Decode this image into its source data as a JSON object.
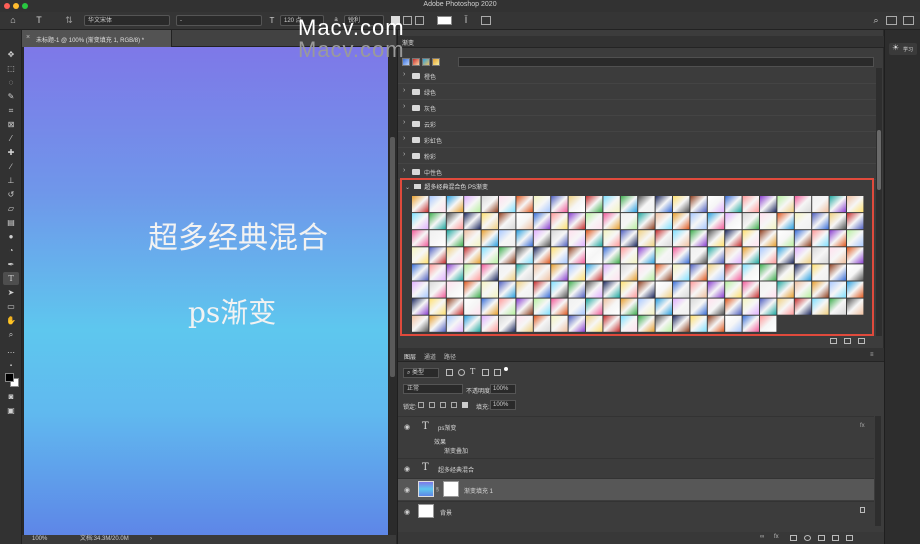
{
  "window": {
    "title": "Adobe Photoshop 2020"
  },
  "options_bar": {
    "font_family": "华文宋体",
    "font_style": "-",
    "font_size": "120 点",
    "antialias": "锐利"
  },
  "document": {
    "tab_title": "未标题-1 @ 100% (渐变填充 1, RGB/8) *",
    "canvas_text_1": "超多经典混合",
    "canvas_text_2": "ps渐变"
  },
  "status": {
    "zoom": "100%",
    "doc_info": "文档:34.3M/20.0M",
    "arrow": "›"
  },
  "gradients_panel": {
    "tab": "渐变",
    "folders": [
      "橙色",
      "绿色",
      "灰色",
      "云彩",
      "彩虹色",
      "粉彩",
      "中性色"
    ],
    "open_folder": "超多经典混合色 PS渐变"
  },
  "watermark": {
    "text": "Macv.com"
  },
  "layers_panel": {
    "tabs": [
      "图层",
      "通道",
      "路径"
    ],
    "filter_label": "类型",
    "blend_mode": "正常",
    "opacity_label": "不透明度:",
    "opacity_value": "100%",
    "lock_label": "锁定:",
    "fill_label": "填充:",
    "fill_value": "100%",
    "fx_label": "fx",
    "layers": [
      {
        "name": "ps渐变",
        "kind": "text"
      },
      {
        "name": "效果",
        "kind": "effects"
      },
      {
        "name": "渐变叠加",
        "kind": "effect"
      },
      {
        "name": "超多经典混合",
        "kind": "text"
      },
      {
        "name": "渐变填充 1",
        "kind": "fill"
      },
      {
        "name": "背景",
        "kind": "background"
      }
    ]
  },
  "right_strip": {
    "learn_label": "学习"
  },
  "colors": {
    "highlight": "#e04a3c",
    "canvas_top": "#7e78e8",
    "canvas_mid": "#5ec7ee",
    "canvas_bottom": "#5e86e7"
  }
}
